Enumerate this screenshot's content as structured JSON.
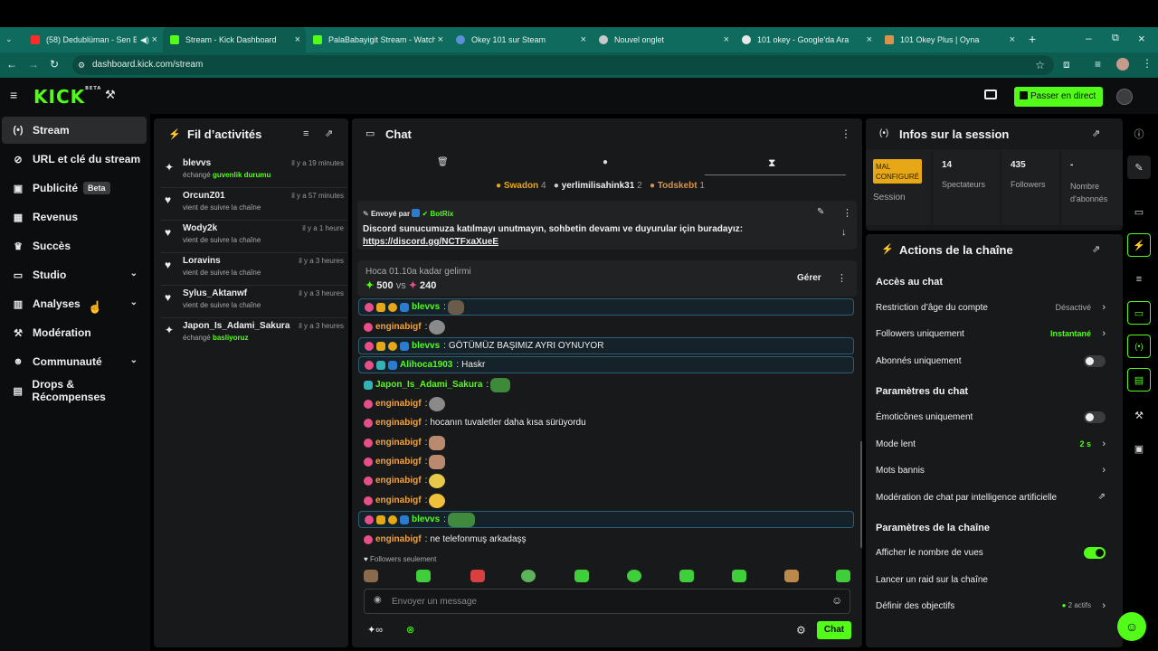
{
  "browser": {
    "tabs": [
      {
        "label": "(58) Dedublüman - Sen Bil",
        "color": "#ff2a2a"
      },
      {
        "label": "Stream - Kick Dashboard",
        "color": "#53fc18"
      },
      {
        "label": "PalaBabayigit Stream - Watch L",
        "color": "#53fc18"
      },
      {
        "label": "Okey 101 sur Steam",
        "color": "#5b8fd6"
      },
      {
        "label": "Nouvel onglet",
        "color": "#c8c8c8"
      },
      {
        "label": "101 okey - Google'da Ara",
        "color": "#e8e8e8"
      },
      {
        "label": "101 Okey Plus | Oyna",
        "color": "#d9934a"
      }
    ],
    "url": "dashboard.kick.com/stream"
  },
  "header": {
    "logo": "KICK",
    "logo_sup": "BETA",
    "live_button": "Passer en direct"
  },
  "nav": {
    "items": [
      {
        "label": "Stream",
        "icon": "(•)"
      },
      {
        "label": "URL et clé du stream",
        "icon": "⊘"
      },
      {
        "label": "Publicité",
        "icon": "▣",
        "badge": "Beta"
      },
      {
        "label": "Revenus",
        "icon": "▦"
      },
      {
        "label": "Succès",
        "icon": "♛"
      },
      {
        "label": "Studio",
        "icon": "▭"
      },
      {
        "label": "Analyses",
        "icon": "▥"
      },
      {
        "label": "Modération",
        "icon": "⚒"
      },
      {
        "label": "Communauté",
        "icon": "☻"
      },
      {
        "label": "Drops & Récompenses",
        "icon": "▤"
      }
    ]
  },
  "feed": {
    "title": "Fil d’activités",
    "items": [
      {
        "name": "blevvs",
        "time": "il y a 19 minutes",
        "sub": "échangé",
        "highlight": "guvenlik durumu",
        "icon": "✦"
      },
      {
        "name": "OrcunZ01",
        "time": "il y a 57 minutes",
        "sub": "vient de suivre la chaîne",
        "highlight": "",
        "icon": "♥"
      },
      {
        "name": "Wody2k",
        "time": "il y a 1 heure",
        "sub": "vient de suivre la chaîne",
        "highlight": "",
        "icon": "♥"
      },
      {
        "name": "Loravins",
        "time": "il y a 3 heures",
        "sub": "vient de suivre la chaîne",
        "highlight": "",
        "icon": "♥"
      },
      {
        "name": "Sylus_Aktanwf",
        "time": "il y a 3 heures",
        "sub": "vient de suivre la chaîne",
        "highlight": "",
        "icon": "♥"
      },
      {
        "name": "Japon_Is_Adami_Sakura",
        "time": "il y a 3 heures",
        "sub": "échangé",
        "highlight": "basliyoruz",
        "icon": "✦"
      }
    ]
  },
  "chat": {
    "title": "Chat",
    "top_users": [
      {
        "name": "Swadon",
        "count": "4"
      },
      {
        "name": "yerlimilisahink31",
        "count": "2"
      },
      {
        "name": "Todskebt",
        "count": "1"
      }
    ],
    "pinned": {
      "label": "Envoyé par",
      "author": "BotRix",
      "text": "Discord sunucumuza katılmayı unutmayın, sohbetin devamı ve duyurular için buradayız:",
      "link": "https://discord.gg/NCTFxaXueE"
    },
    "prediction": {
      "title": "Hoca 01.10a kadar gelirmi",
      "a": "500",
      "vs": "vs",
      "b": "240",
      "manage": "Gérer"
    },
    "messages": [
      {
        "user": "blevvs",
        "text": "",
        "color": "#53fc18",
        "boxed": true
      },
      {
        "user": "enginabigf",
        "text": "",
        "color": "#f2a23b",
        "boxed": false
      },
      {
        "user": "blevvs",
        "text": "GÖTÜMÜZ BAŞIMIZ AYRI OYNUYOR",
        "color": "#53fc18",
        "boxed": true
      },
      {
        "user": "Alihoca1903",
        "text": "Haskr",
        "color": "#53fc18",
        "boxed": true
      },
      {
        "user": "Japon_Is_Adami_Sakura",
        "text": "",
        "color": "#53fc18",
        "boxed": false
      },
      {
        "user": "enginabigf",
        "text": "",
        "color": "#f2a23b",
        "boxed": false
      },
      {
        "user": "enginabigf",
        "text": "hocanın tuvaletler daha kısa sürüyordu",
        "color": "#f2a23b",
        "boxed": false
      },
      {
        "user": "enginabigf",
        "text": "",
        "color": "#f2a23b",
        "boxed": false
      },
      {
        "user": "enginabigf",
        "text": "",
        "color": "#f2a23b",
        "boxed": false
      },
      {
        "user": "enginabigf",
        "text": "",
        "color": "#f2a23b",
        "boxed": false
      },
      {
        "user": "enginabigf",
        "text": "",
        "color": "#f2a23b",
        "boxed": false
      },
      {
        "user": "blevvs",
        "text": "",
        "color": "#53fc18",
        "boxed": true
      },
      {
        "user": "enginabigf",
        "text": "ne telefonmuş arkadaşş",
        "color": "#f2a23b",
        "boxed": false
      }
    ],
    "followers_only": "Followers seulement",
    "input_placeholder": "Envoyer un message",
    "send_label": "Chat"
  },
  "session": {
    "title": "Infos sur la session",
    "status_badge": "MAL CONFIGURÉ",
    "session_label": "Session",
    "viewers_value": "14",
    "viewers_label": "Spectateurs",
    "followers_value": "435",
    "followers_label": "Followers",
    "subs_value": "-",
    "subs_label": "Nombre d'abonnés"
  },
  "actions": {
    "title": "Actions de la chaîne",
    "section1": "Accès au chat",
    "age_label": "Restriction d’âge du compte",
    "age_value": "Désactivé",
    "followers_only_label": "Followers uniquement",
    "followers_only_value": "Instantané",
    "subs_only_label": "Abonnés uniquement",
    "section2": "Paramètres du chat",
    "emotes_only_label": "Émoticônes uniquement",
    "slow_label": "Mode lent",
    "slow_value": "2 s",
    "banned_label": "Mots bannis",
    "ai_mod_label": "Modération de chat par intelligence artificielle",
    "section3": "Paramètres de la chaîne",
    "views_label": "Afficher le nombre de vues",
    "raid_label": "Lancer un raid sur la chaîne",
    "goals_label": "Définir des objectifs",
    "goals_value": "2 actifs"
  },
  "colors": {
    "accent": "#53fc18",
    "panel": "#18191b",
    "bg": "#0c0d0e"
  }
}
